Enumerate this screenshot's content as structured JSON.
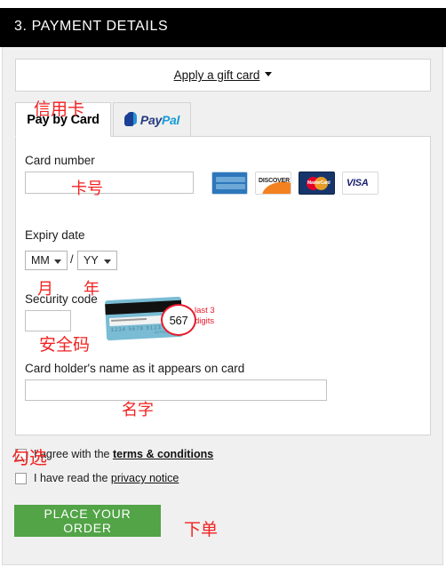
{
  "section": {
    "title": "3. PAYMENT DETAILS"
  },
  "giftcard": {
    "link_label": "Apply a gift card",
    "caret_icon": "chevron-down-icon"
  },
  "tabs": [
    {
      "id": "card",
      "label": "Pay by Card",
      "active": true
    },
    {
      "id": "paypal",
      "label": "PayPal",
      "logo_pay": "Pay",
      "logo_pal": "Pal",
      "active": false
    }
  ],
  "form": {
    "card_number": {
      "label": "Card number",
      "value": "",
      "placeholder": ""
    },
    "accepted_brands": [
      {
        "name": "american-express",
        "text": "AMERICAN EXPRESS"
      },
      {
        "name": "discover",
        "text": "DISCOVER"
      },
      {
        "name": "mastercard",
        "text": "MasterCard"
      },
      {
        "name": "visa",
        "text": "VISA"
      }
    ],
    "expiry": {
      "label": "Expiry date",
      "month_value": "MM",
      "year_value": "YY",
      "separator": "/"
    },
    "security_code": {
      "label": "Security code",
      "value": "",
      "hint_number": "567",
      "hint_line1": "last 3",
      "hint_line2": "digits",
      "card_digits": "1234  5678  9123  4567",
      "card_small1": "VALID",
      "card_small2": "AUTHORIZED"
    },
    "holder_name": {
      "label": "Card holder's name as it appears on card",
      "value": "",
      "placeholder": ""
    }
  },
  "agreements": {
    "terms": {
      "prefix": "I agree with the ",
      "link": "terms & conditions",
      "checked": false
    },
    "privacy": {
      "prefix": "I have read the ",
      "link": "privacy notice",
      "checked": false
    }
  },
  "actions": {
    "place_order_label": "PLACE YOUR ORDER"
  },
  "annotations": {
    "credit_card": "信用卡",
    "card_number": "卡号",
    "month": "月",
    "year": "年",
    "security_code": "安全码",
    "name": "名字",
    "check": "勾选",
    "place_order": "下单"
  },
  "colors": {
    "header_bg": "#000000",
    "panel_bg": "#f0f0f0",
    "form_bg": "#ffffff",
    "accent_green": "#52a447",
    "annotation_red": "#f22222",
    "cvv_circle_red": "#e8192c",
    "paypal_dark": "#253b80",
    "paypal_light": "#179bd7"
  }
}
